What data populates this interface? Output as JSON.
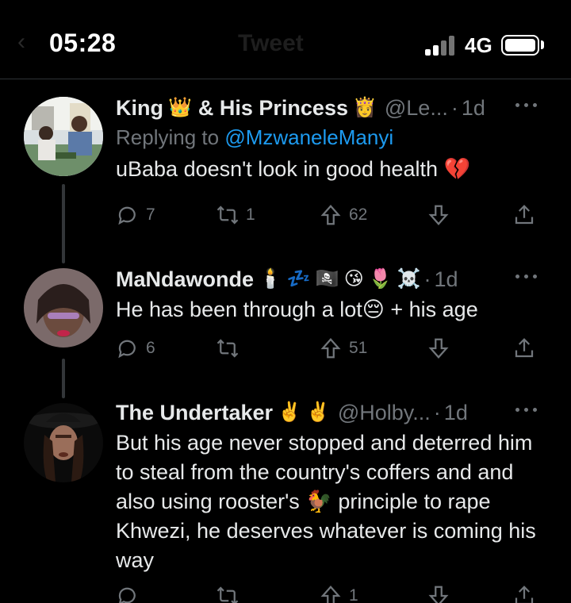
{
  "status_bar": {
    "time": "05:28",
    "network": "4G"
  },
  "background_nav": {
    "back_glyph": "‹",
    "title": "Tweet"
  },
  "colors": {
    "background": "#000000",
    "text": "#e7e9ea",
    "muted": "#71767b",
    "link": "#1d9bf0",
    "divider": "#2f3336"
  },
  "tweets": [
    {
      "name": "King",
      "name_suffix": "& His Princess",
      "name_emojis": [
        "👑"
      ],
      "suffix_emojis": [
        "👸"
      ],
      "handle": "@Le...",
      "time": "1d",
      "replying_prefix": "Replying to",
      "replying_mention": "@MzwaneleManyi",
      "text": "uBaba doesn't look in good health 💔",
      "replies": "7",
      "retweets": "1",
      "upvotes": "62"
    },
    {
      "name": "MaNdawonde",
      "name_emojis": [
        "🕯️",
        "💤",
        "🏴‍☠️",
        "😘",
        "🌷",
        "☠️"
      ],
      "handle": "",
      "time": "1d",
      "text": "He has been through a lot😔 + his age",
      "replies": "6",
      "retweets": "",
      "upvotes": "51"
    },
    {
      "name": "The Undertaker",
      "name_emojis": [
        "✌️",
        "✌️"
      ],
      "handle": "@Holby...",
      "time": "1d",
      "text": "But his age never stopped and deterred him to steal from the country's coffers and and also using rooster's 🐓 principle to rape Khwezi, he deserves whatever is coming his way",
      "replies": "",
      "retweets": "",
      "upvotes": "1"
    }
  ]
}
